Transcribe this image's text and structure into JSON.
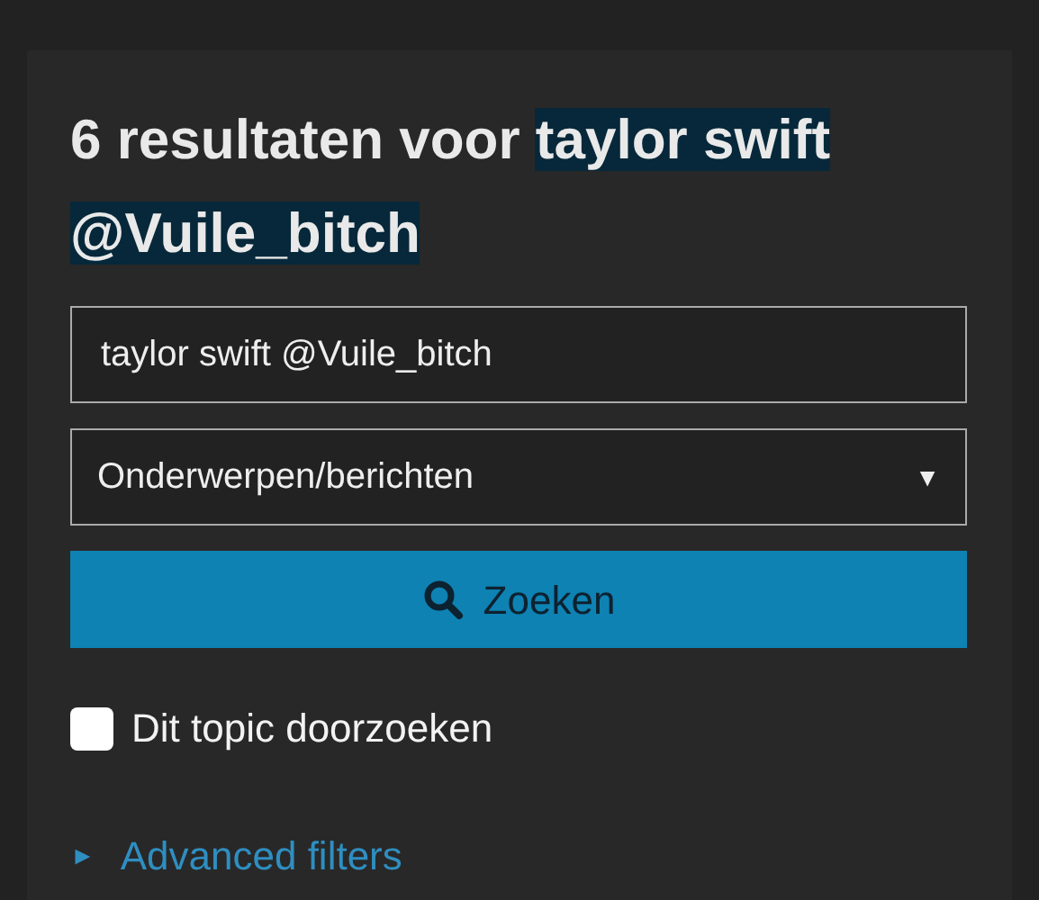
{
  "heading": {
    "prefix": "6 resultaten voor ",
    "highlight": "taylor swift @Vuile_bitch"
  },
  "search": {
    "value": "taylor swift @Vuile_bitch"
  },
  "scope": {
    "value": "Onderwerpen/berichten",
    "caret": "▼"
  },
  "button": {
    "label": "Zoeken"
  },
  "topic_checkbox": {
    "label": "Dit topic doorzoeken",
    "checked": false
  },
  "advanced": {
    "toggle": "►",
    "label": "Advanced filters",
    "expanded": false
  }
}
